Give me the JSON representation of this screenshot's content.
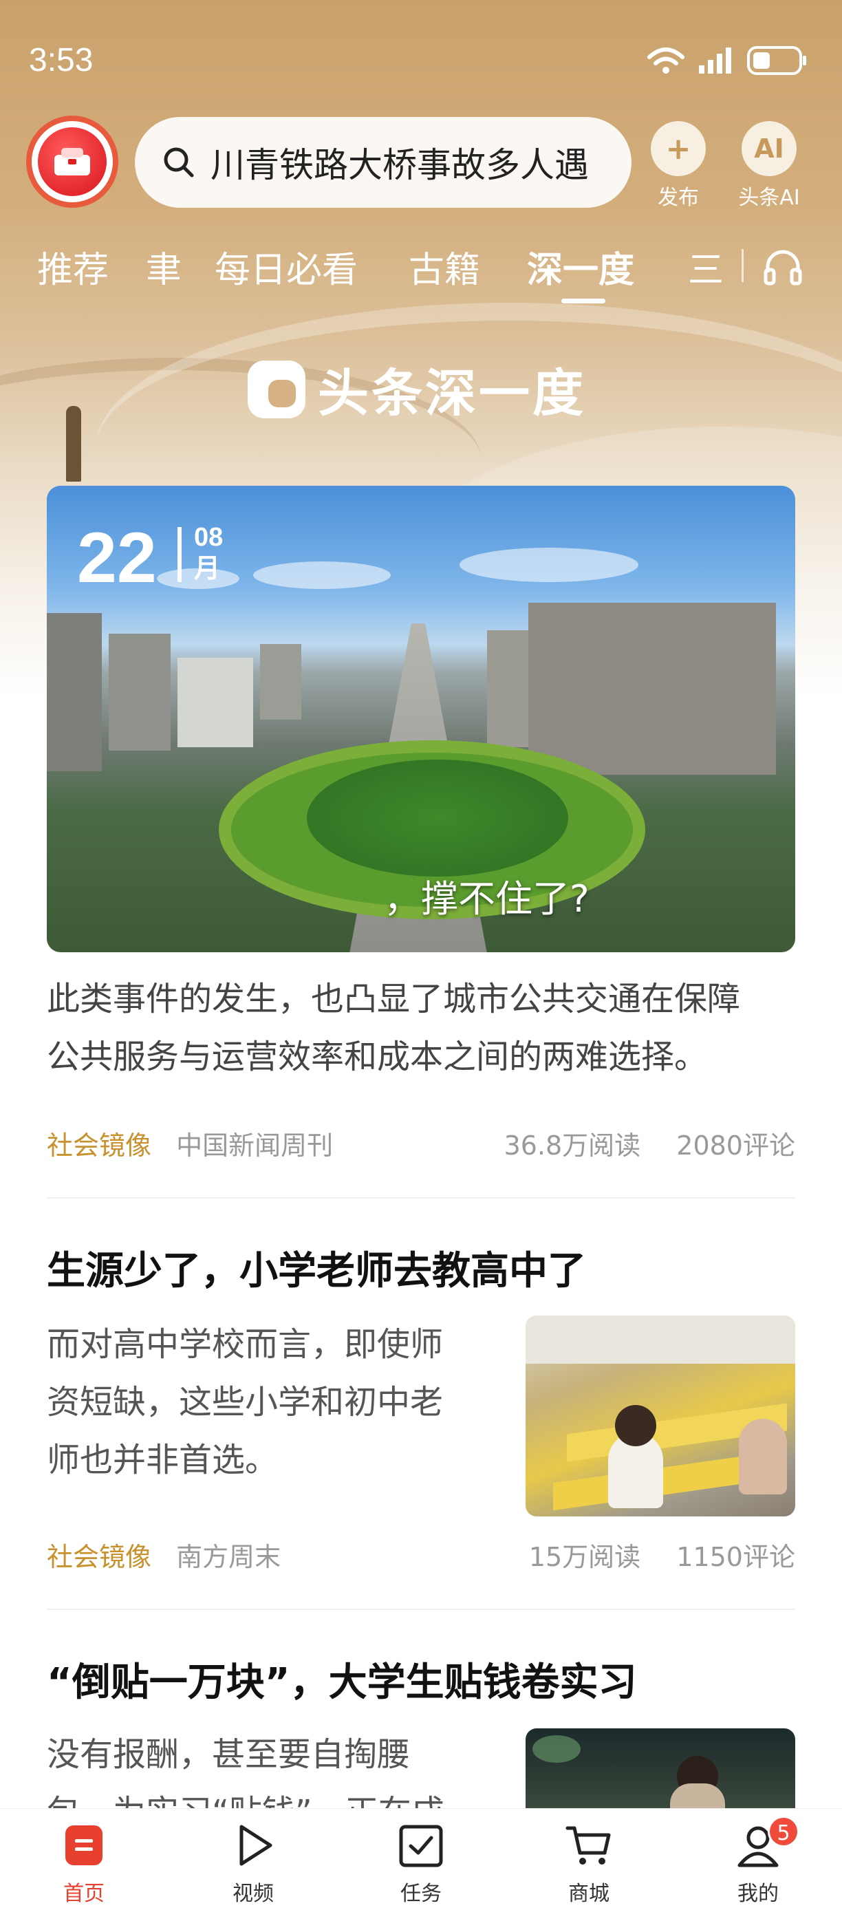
{
  "status_bar": {
    "time": "3:53"
  },
  "header": {
    "search_text": "川青铁路大桥事故多人遇",
    "publish_label": "发布",
    "publish_icon": "plus-icon",
    "ai_label": "头条AI",
    "ai_icon_text": "AI"
  },
  "tabs": [
    {
      "label": "推荐"
    },
    {
      "label": "聿"
    },
    {
      "label": "每日必看"
    },
    {
      "label": "古籍"
    },
    {
      "label": "深一度",
      "active": true
    },
    {
      "label": "三"
    }
  ],
  "banner": {
    "title": "头条深一度"
  },
  "feature": {
    "day": "22",
    "month_num": "08",
    "month_char": "月",
    "caption": "，撑不住了?",
    "summary_line1": "此类事件的发生，也凸显了城市公共交通在保障",
    "summary_line2": "公共服务与运营效率和成本之间的两难选择。",
    "tag": "社会镜像",
    "source": "中国新闻周刊",
    "reads": "36.8万阅读",
    "comments": "2080评论"
  },
  "articles": [
    {
      "title": "生源少了，小学老师去教高中了",
      "summary_lines": [
        "而对高中学校而言，即使师",
        "资短缺，这些小学和初中老",
        "师也并非首选。"
      ],
      "tag": "社会镜像",
      "source": "南方周末",
      "reads": "15万阅读",
      "comments": "1150评论"
    },
    {
      "title": "“倒贴一万块”，大学生贴钱卷实习",
      "summary_lines": [
        "没有报酬，甚至要自掏腰",
        "包，为实习“贴钱”，正在成"
      ]
    }
  ],
  "bottom_nav": [
    {
      "label": "首页",
      "icon": "home-icon",
      "active": true
    },
    {
      "label": "视频",
      "icon": "play-icon"
    },
    {
      "label": "任务",
      "icon": "checkbox-icon"
    },
    {
      "label": "商城",
      "icon": "cart-icon"
    },
    {
      "label": "我的",
      "icon": "profile-icon",
      "badge": "5"
    }
  ],
  "colors": {
    "accent": "#e8402e",
    "gold": "#c8912e",
    "header_bg": "#c9a16c"
  }
}
